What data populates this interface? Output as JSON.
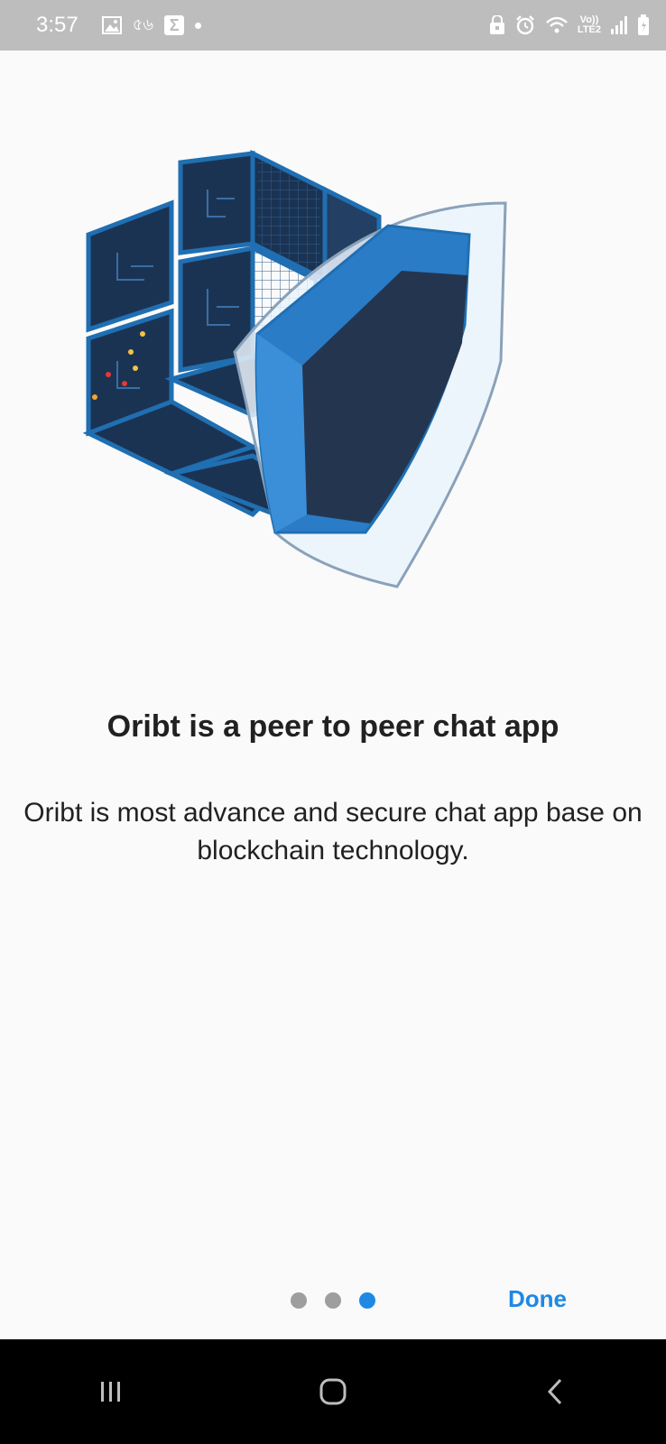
{
  "status_bar": {
    "time": "3:57",
    "carrier_text": "৫৬",
    "volte_line1": "Vo))",
    "volte_line2": "LTE2",
    "icons": [
      "gallery-icon",
      "sigma-icon",
      "notification-dot-icon",
      "lock-icon",
      "alarm-icon",
      "wifi-icon",
      "signal-icon",
      "battery-icon"
    ]
  },
  "onboarding": {
    "title": "Oribt is a peer to peer chat app",
    "description": "Oribt is most advance and secure chat app base on blockchain technology.",
    "pages_total": 3,
    "current_page": 3,
    "done_label": "Done"
  },
  "nav_bar": {
    "buttons": [
      "recent-apps-icon",
      "home-icon",
      "back-icon"
    ]
  },
  "colors": {
    "accent": "#1e88e5",
    "status_bar": "#bdbdbd",
    "background": "#fafafa",
    "cube_dark": "#1b3353",
    "cube_edge": "#1f6fb2",
    "shield_dark": "#24364f"
  }
}
